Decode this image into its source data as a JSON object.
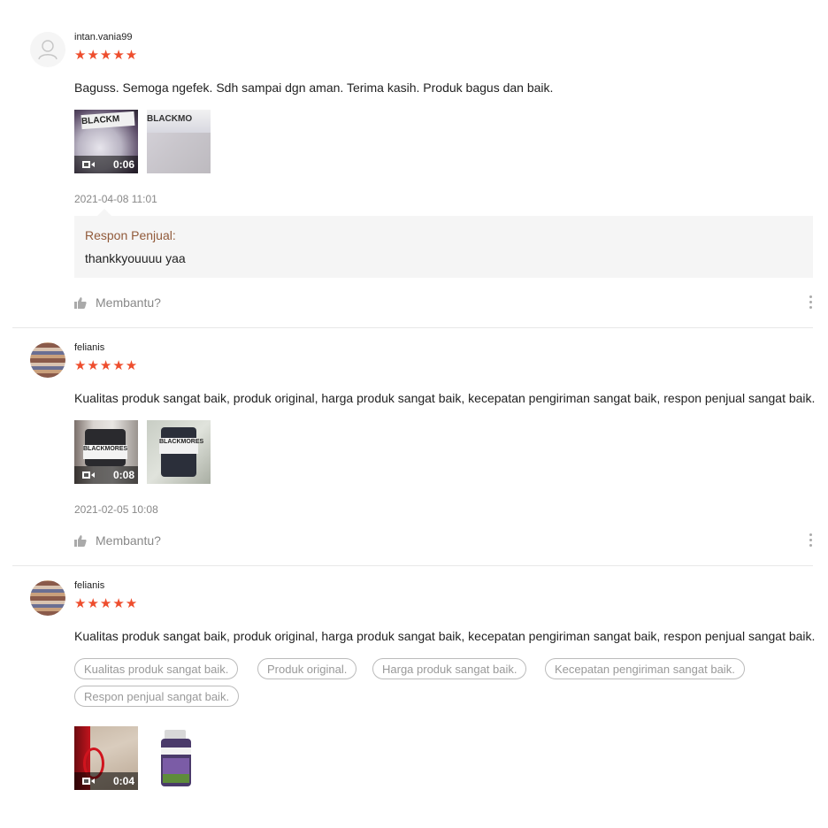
{
  "reviews": [
    {
      "username": "intan.vania99",
      "stars": "★★★★★",
      "comment": "Baguss. Semoga ngefek. Sdh sampai dgn aman. Terima kasih. Produk bagus dan baik.",
      "video_duration": "0:06",
      "date": "2021-04-08 11:01",
      "seller_label": "Respon Penjual:",
      "seller_text": "thankkyouuuu yaa",
      "helpful_label": "Membantu?"
    },
    {
      "username": "felianis",
      "stars": "★★★★★",
      "comment": "Kualitas produk sangat baik, produk original, harga produk sangat baik, kecepatan pengiriman sangat baik, respon penjual sangat baik.",
      "video_duration": "0:08",
      "date": "2021-02-05 10:08",
      "helpful_label": "Membantu?"
    },
    {
      "username": "felianis",
      "stars": "★★★★★",
      "comment": "Kualitas produk sangat baik, produk original, harga produk sangat baik, kecepatan pengiriman sangat baik, respon penjual sangat baik.",
      "tags": [
        "Kualitas produk sangat baik.",
        "Produk original.",
        "Harga produk sangat baik.",
        "Kecepatan pengiriman sangat baik.",
        "Respon penjual sangat baik."
      ],
      "video_duration": "0:04"
    }
  ],
  "colors": {
    "star": "#ee4d2d",
    "seller_label": "#915a3a",
    "muted": "#888888"
  }
}
